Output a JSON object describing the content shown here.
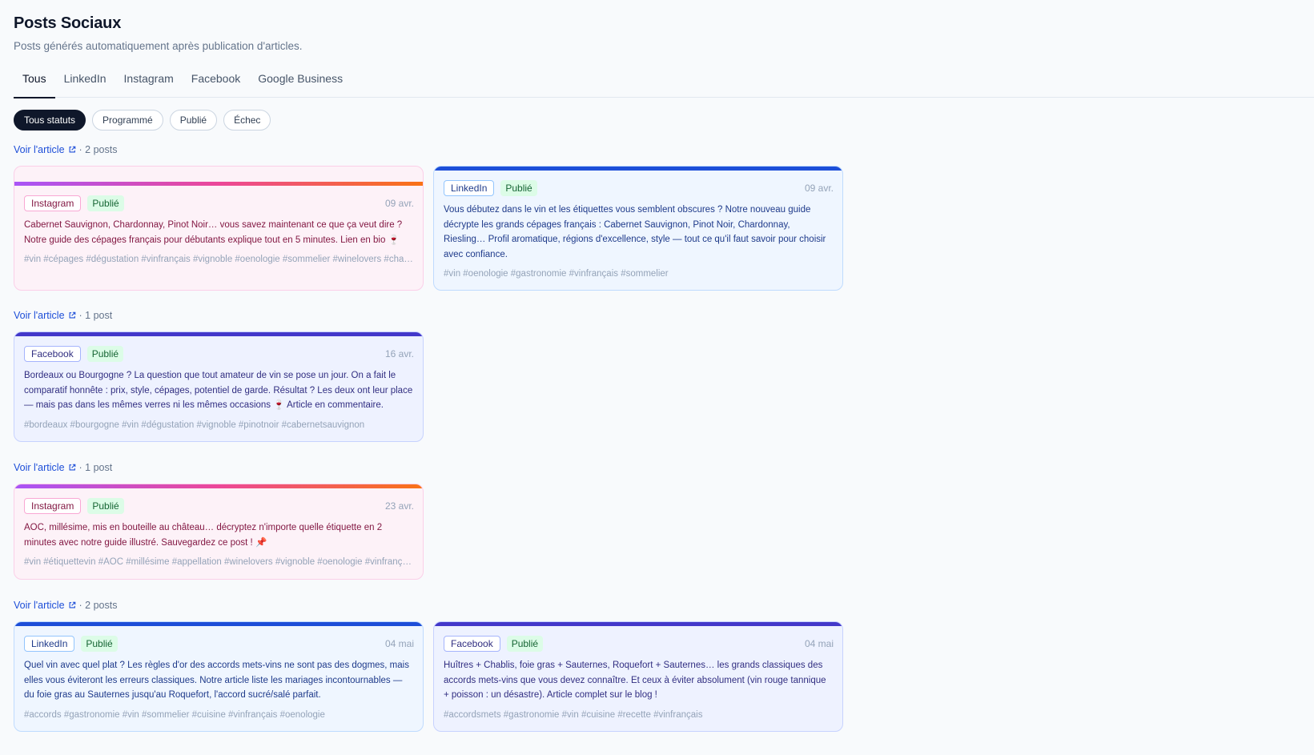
{
  "header": {
    "title": "Posts Sociaux",
    "subtitle": "Posts générés automatiquement après publication d'articles."
  },
  "tabs": [
    {
      "label": "Tous",
      "active": true
    },
    {
      "label": "LinkedIn",
      "active": false
    },
    {
      "label": "Instagram",
      "active": false
    },
    {
      "label": "Facebook",
      "active": false
    },
    {
      "label": "Google Business",
      "active": false
    }
  ],
  "filters": [
    {
      "label": "Tous statuts",
      "active": true
    },
    {
      "label": "Programmé",
      "active": false
    },
    {
      "label": "Publié",
      "active": false
    },
    {
      "label": "Échec",
      "active": false
    }
  ],
  "icons": {
    "external_link": "external-link-icon"
  },
  "colors": {
    "instagram_gradient": [
      "#a855f7",
      "#ec4899",
      "#f97316"
    ],
    "linkedin_accent": "#1d4ed8",
    "facebook_accent": "#4338ca",
    "status_published_bg": "#dcfce7",
    "status_published_text": "#166534",
    "link": "#1d4ed8"
  },
  "groups": [
    {
      "link_label": "Voir l'article",
      "count_label": "· 2 posts",
      "posts": [
        {
          "platform": "Instagram",
          "status": "Publié",
          "date": "09 avr.",
          "text": "Cabernet Sauvignon, Chardonnay, Pinot Noir… vous savez maintenant ce que ça veut dire ? Notre guide des cépages français pour débutants explique tout en 5 minutes. Lien en bio 🍷",
          "tags": "#vin #cépages #dégustation #vinfrançais #vignoble #oenologie #sommelier #winelovers #champagne #bordeaux"
        },
        {
          "platform": "LinkedIn",
          "status": "Publié",
          "date": "09 avr.",
          "text": "Vous débutez dans le vin et les étiquettes vous semblent obscures ? Notre nouveau guide décrypte les grands cépages français : Cabernet Sauvignon, Pinot Noir, Chardonnay, Riesling… Profil aromatique, régions d'excellence, style — tout ce qu'il faut savoir pour choisir avec confiance.",
          "tags": "#vin #oenologie #gastronomie #vinfrançais #sommelier"
        }
      ]
    },
    {
      "link_label": "Voir l'article",
      "count_label": "· 1 post",
      "posts": [
        {
          "platform": "Facebook",
          "status": "Publié",
          "date": "16 avr.",
          "text": "Bordeaux ou Bourgogne ? La question que tout amateur de vin se pose un jour. On a fait le comparatif honnête : prix, style, cépages, potentiel de garde. Résultat ? Les deux ont leur place — mais pas dans les mêmes verres ni les mêmes occasions 🍷 Article en commentaire.",
          "tags": "#bordeaux #bourgogne #vin #dégustation #vignoble #pinotnoir #cabernetsauvignon"
        }
      ]
    },
    {
      "link_label": "Voir l'article",
      "count_label": "· 1 post",
      "posts": [
        {
          "platform": "Instagram",
          "status": "Publié",
          "date": "23 avr.",
          "text": "AOC, millésime, mis en bouteille au château… décryptez n'importe quelle étiquette en 2 minutes avec notre guide illustré. Sauvegardez ce post ! 📌",
          "tags": "#vin #étiquettevin #AOC #millésime #appellation #winelovers #vignoble #oenologie #vinfrançais #sommelier"
        }
      ]
    },
    {
      "link_label": "Voir l'article",
      "count_label": "· 2 posts",
      "posts": [
        {
          "platform": "LinkedIn",
          "status": "Publié",
          "date": "04 mai",
          "text": "Quel vin avec quel plat ? Les règles d'or des accords mets-vins ne sont pas des dogmes, mais elles vous éviteront les erreurs classiques. Notre article liste les mariages incontournables — du foie gras au Sauternes jusqu'au Roquefort, l'accord sucré/salé parfait.",
          "tags": "#accords #gastronomie #vin #sommelier #cuisine #vinfrançais #oenologie"
        },
        {
          "platform": "Facebook",
          "status": "Publié",
          "date": "04 mai",
          "text": "Huîtres + Chablis, foie gras + Sauternes, Roquefort + Sauternes… les grands classiques des accords mets-vins que vous devez connaître. Et ceux à éviter absolument (vin rouge tannique + poisson : un désastre). Article complet sur le blog !",
          "tags": "#accordsmets #gastronomie #vin #cuisine #recette #vinfrançais"
        }
      ]
    }
  ]
}
